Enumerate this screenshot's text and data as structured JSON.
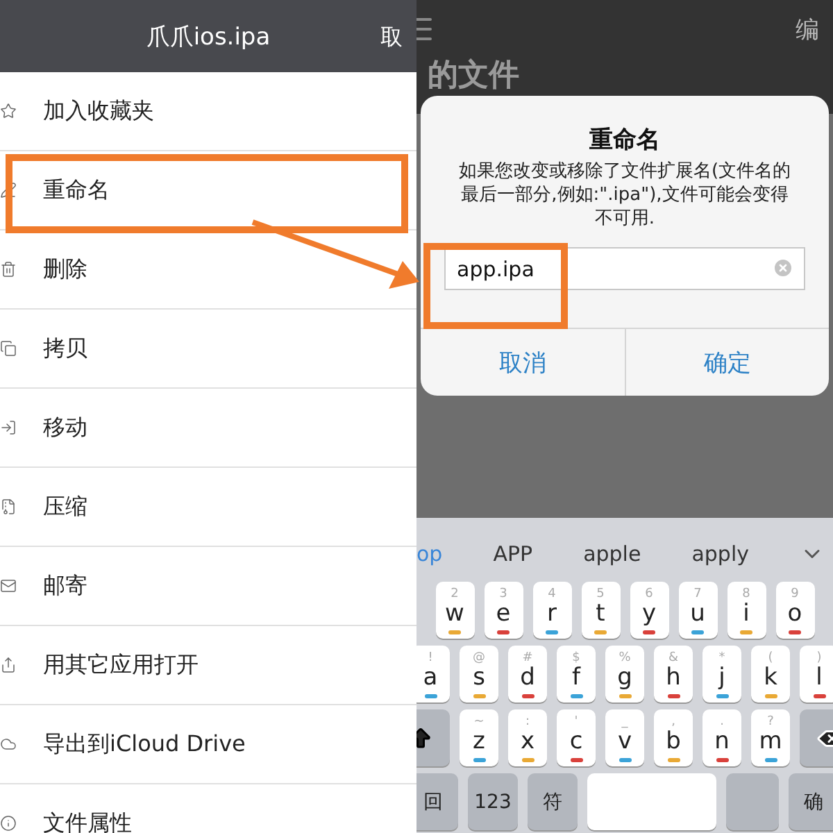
{
  "left": {
    "header": {
      "title": "爪爪ios.ipa",
      "cancel": "取"
    },
    "menu": [
      {
        "kind": "star",
        "label": "加入收藏夹",
        "highlighted": false
      },
      {
        "kind": "rename",
        "label": "重命名",
        "highlighted": true
      },
      {
        "kind": "trash",
        "label": "删除",
        "highlighted": false
      },
      {
        "kind": "copy",
        "label": "拷贝",
        "highlighted": false
      },
      {
        "kind": "move",
        "label": "移动",
        "highlighted": false
      },
      {
        "kind": "zip",
        "label": "压缩",
        "highlighted": false
      },
      {
        "kind": "mail",
        "label": "邮寄",
        "highlighted": false
      },
      {
        "kind": "share",
        "label": "用其它应用打开",
        "highlighted": false
      },
      {
        "kind": "cloud",
        "label": "导出到iCloud Drive",
        "highlighted": false
      },
      {
        "kind": "info",
        "label": "文件属性",
        "highlighted": false
      }
    ]
  },
  "right": {
    "header": {
      "edit": "编"
    },
    "page_title": "的文件",
    "dialog": {
      "title": "重命名",
      "message": "如果您改变或移除了文件扩展名(文件名的最后一部分,例如:\".ipa\"),文件可能会变得不可用.",
      "value": "app.ipa",
      "highlighted": true,
      "buttons": [
        "取消",
        "确定"
      ]
    },
    "keyboard": {
      "suggestions": [
        {
          "text": "op",
          "selected": true
        },
        {
          "text": "APP",
          "selected": false
        },
        {
          "text": "apple",
          "selected": false
        },
        {
          "text": "apply",
          "selected": false
        }
      ],
      "rows": [
        [
          {
            "kind": "letter",
            "hint": "2",
            "letter": "w",
            "color": "#e9a935"
          },
          {
            "kind": "letter",
            "hint": "3",
            "letter": "e",
            "color": "#d9413b"
          },
          {
            "kind": "letter",
            "hint": "4",
            "letter": "r",
            "color": "#3ba3d8"
          },
          {
            "kind": "letter",
            "hint": "5",
            "letter": "t",
            "color": "#e9a935"
          },
          {
            "kind": "letter",
            "hint": "6",
            "letter": "y",
            "color": "#d9413b"
          },
          {
            "kind": "letter",
            "hint": "7",
            "letter": "u",
            "color": "#3ba3d8"
          },
          {
            "kind": "letter",
            "hint": "8",
            "letter": "i",
            "color": "#e9a935"
          },
          {
            "kind": "letter",
            "hint": "9",
            "letter": "o",
            "color": "#d9413b"
          }
        ],
        [
          {
            "kind": "letter",
            "hint": "!",
            "letter": "a",
            "color": "#3ba3d8"
          },
          {
            "kind": "letter",
            "hint": "@",
            "letter": "s",
            "color": "#e9a935"
          },
          {
            "kind": "letter",
            "hint": "#",
            "letter": "d",
            "color": "#d9413b"
          },
          {
            "kind": "letter",
            "hint": "$",
            "letter": "f",
            "color": "#3ba3d8"
          },
          {
            "kind": "letter",
            "hint": "%",
            "letter": "g",
            "color": "#e9a935"
          },
          {
            "kind": "letter",
            "hint": "&",
            "letter": "h",
            "color": "#d9413b"
          },
          {
            "kind": "letter",
            "hint": "*",
            "letter": "j",
            "color": "#3ba3d8"
          },
          {
            "kind": "letter",
            "hint": "(",
            "letter": "k",
            "color": "#e9a935"
          },
          {
            "kind": "letter",
            "hint": ")",
            "letter": "l",
            "color": "#d9413b"
          }
        ],
        [
          {
            "kind": "shift"
          },
          {
            "kind": "letter",
            "hint": "~",
            "letter": "z",
            "color": "#3ba3d8"
          },
          {
            "kind": "letter",
            "hint": ":",
            "letter": "x",
            "color": "#e9a935"
          },
          {
            "kind": "letter",
            "hint": "'",
            "letter": "c",
            "color": "#d9413b"
          },
          {
            "kind": "letter",
            "hint": "_",
            "letter": "v",
            "color": "#3ba3d8"
          },
          {
            "kind": "letter",
            "hint": ",",
            "letter": "b",
            "color": "#e9a935"
          },
          {
            "kind": "letter",
            "hint": ".",
            "letter": "n",
            "color": "#d9413b"
          },
          {
            "kind": "letter",
            "hint": "?",
            "letter": "m",
            "color": "#3ba3d8"
          },
          {
            "kind": "delete"
          }
        ]
      ],
      "bottom_row": [
        {
          "kind": "text",
          "label": "回"
        },
        {
          "kind": "text",
          "label": "123"
        },
        {
          "kind": "text",
          "label": "符"
        },
        {
          "kind": "space"
        },
        {
          "kind": "blank"
        },
        {
          "kind": "text",
          "label": "确"
        }
      ]
    }
  }
}
